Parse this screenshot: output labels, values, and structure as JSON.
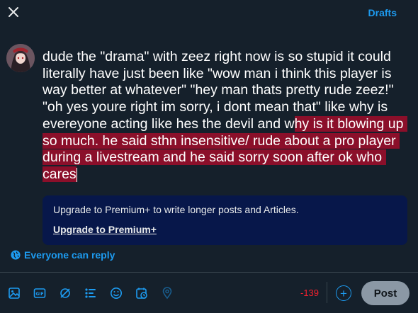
{
  "header": {
    "drafts_label": "Drafts"
  },
  "composer": {
    "text_before_highlight": "dude the \"drama\" with zeez right now is so stupid it could literally have just been like \"wow man i think this player is way better at whatever\" \"hey man thats pretty rude zeez!\" \"oh yes youre right im sorry, i dont mean that\" like why is evereyone acting like hes the devil and w",
    "text_highlighted": "hy is it blowing up so much. he said sthn insensitive/ rude about a pro player during a livestream and he said sorry soon after ok who cares",
    "remaining_chars": "-139"
  },
  "premium": {
    "message": "Upgrade to Premium+ to write longer posts and Articles.",
    "link_label": "Upgrade to Premium+"
  },
  "reply_setting": {
    "label": "Everyone can reply"
  },
  "toolbar": {
    "icons": [
      "image-icon",
      "gif-icon",
      "grok-icon",
      "poll-icon",
      "emoji-icon",
      "schedule-icon",
      "location-icon"
    ],
    "post_label": "Post",
    "add_label": "+"
  },
  "colors": {
    "background": "#15202b",
    "accent": "#1d9bf0",
    "highlight": "#8b0f2a",
    "premium_box": "#07174a",
    "over_limit": "#f4212e",
    "post_button_disabled": "#8b98a5"
  }
}
